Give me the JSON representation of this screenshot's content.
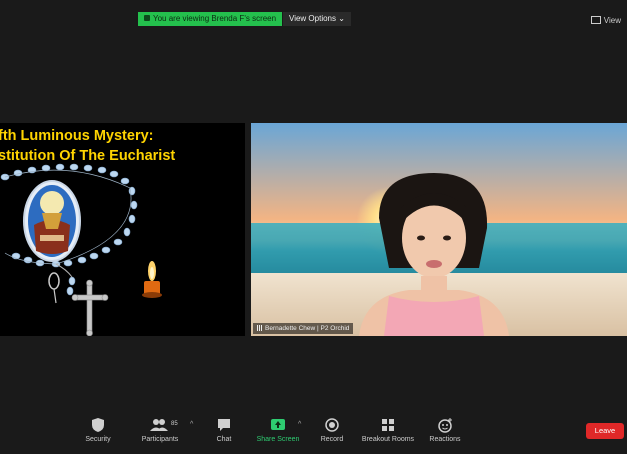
{
  "top": {
    "share_banner": "You are viewing Brenda F's screen",
    "view_options": "View Options",
    "view_button": "View"
  },
  "slide": {
    "title_line1": "fth Luminous Mystery:",
    "title_line2": "stitution Of The Eucharist",
    "title_color": "#ffd400"
  },
  "participant": {
    "name": "Bernadette Chew | P2 Orchid"
  },
  "toolbar": {
    "security": "Security",
    "participants": "Participants",
    "participants_count": "85",
    "chat": "Chat",
    "share_screen": "Share Screen",
    "record": "Record",
    "breakout_rooms": "Breakout Rooms",
    "reactions": "Reactions",
    "leave": "Leave"
  },
  "colors": {
    "share_green": "#24c04d",
    "leave_red": "#e02828",
    "background": "#1a1a1a"
  }
}
